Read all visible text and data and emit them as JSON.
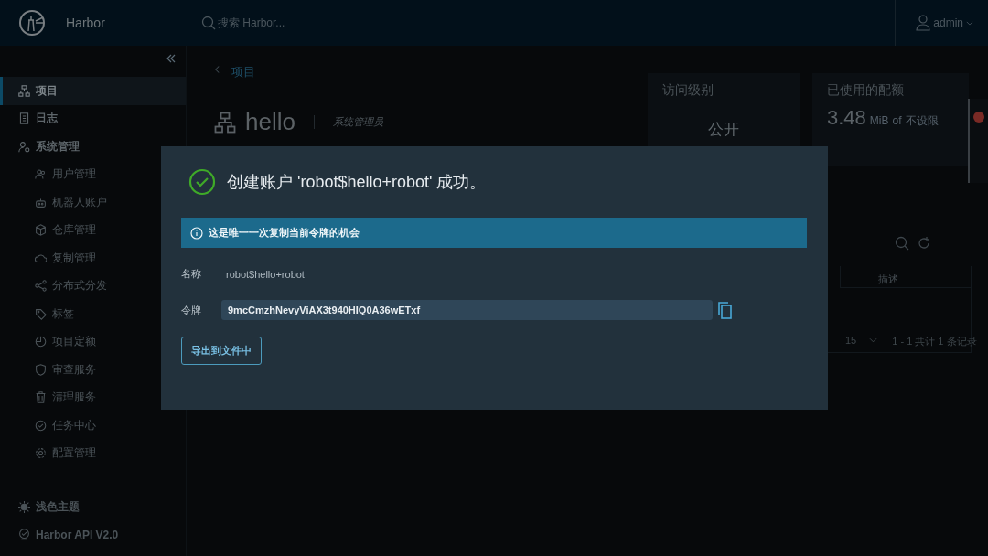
{
  "header": {
    "logo_text": "Harbor",
    "search": {
      "placeholder": "搜索 Harbor..."
    },
    "user": "admin"
  },
  "sidebar": {
    "items": [
      {
        "label": "项目",
        "selected": true
      },
      {
        "label": "日志",
        "selected": false
      },
      {
        "label": "系统管理",
        "selected": false,
        "children": [
          {
            "label": "用户管理",
            "selected": false
          },
          {
            "label": "机器人账户",
            "selected": false
          },
          {
            "label": "仓库管理",
            "selected": false
          },
          {
            "label": "复制管理",
            "selected": false
          },
          {
            "label": "分布式分发",
            "selected": false
          },
          {
            "label": "标签",
            "selected": false
          },
          {
            "label": "项目定额",
            "selected": false
          },
          {
            "label": "审查服务",
            "selected": false
          },
          {
            "label": "清理服务",
            "selected": false
          },
          {
            "label": "任务中心",
            "selected": false
          },
          {
            "label": "配置管理",
            "selected": false
          }
        ]
      }
    ],
    "footer": [
      "浅色主题",
      "Harbor API V2.0"
    ]
  },
  "page": {
    "breadcrumb": "项目",
    "project": "hello",
    "role": "系统管理员",
    "access": {
      "label": "访问级别",
      "value": "公开"
    },
    "quota": {
      "label": "已使用的配额",
      "amount": "3.48",
      "unit": "MiB",
      "of": "of",
      "limit": "不设限"
    },
    "table": {
      "column_2": "描述",
      "page_size": "15",
      "summary": "1 - 1 共计 1 条记录"
    }
  },
  "dialog": {
    "title": "创建账户 'robot$hello+robot' 成功。",
    "info": "这是唯一一次复制当前令牌的机会",
    "fields": [
      {
        "label": "名称",
        "value": "robot$hello+robot",
        "kind": "text"
      },
      {
        "label": "令牌",
        "value": "9mcCmzhNevyViAX3t940HIQ0A36wETxf",
        "kind": "token"
      }
    ],
    "button": "导出到文件中"
  }
}
